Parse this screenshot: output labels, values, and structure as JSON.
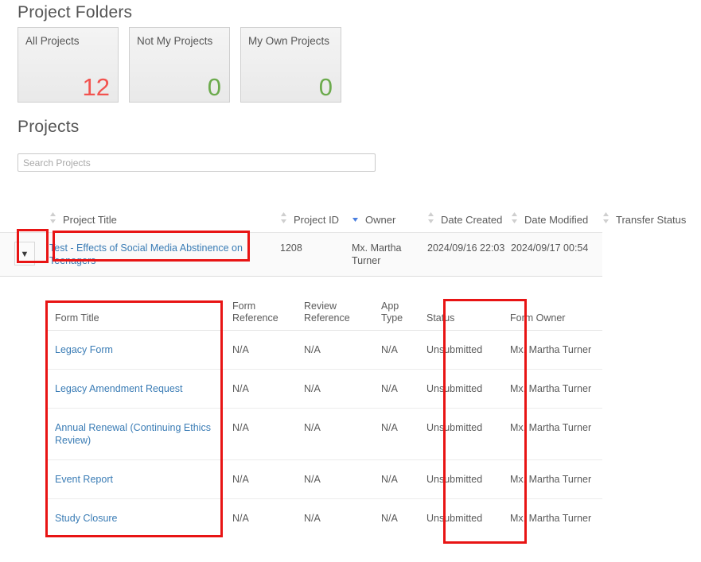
{
  "headings": {
    "project_folders": "Project Folders",
    "projects": "Projects"
  },
  "folder_cards": [
    {
      "label": "All Projects",
      "count": "12",
      "color": "#f2534f"
    },
    {
      "label": "Not My Projects",
      "count": "0",
      "color": "#6cab4d"
    },
    {
      "label": "My Own Projects",
      "count": "0",
      "color": "#6cab4d"
    }
  ],
  "search": {
    "placeholder": "Search Projects",
    "value": ""
  },
  "projects_table": {
    "columns": [
      {
        "label": "Project Title",
        "sort": "none"
      },
      {
        "label": "Project ID",
        "sort": "desc"
      },
      {
        "label": "Owner",
        "sort": "none"
      },
      {
        "label": "Date Created",
        "sort": "none"
      },
      {
        "label": "Date Modified",
        "sort": "none"
      },
      {
        "label": "Transfer Status",
        "sort": "none"
      }
    ],
    "rows": [
      {
        "expander_icon": "chevron-down",
        "title": "Test - Effects of Social Media Abstinence on Teenagers",
        "project_id": "1208",
        "owner": "Mx. Martha Turner",
        "date_created": "2024/09/16 22:03",
        "date_modified": "2024/09/17 00:54",
        "transfer_status": ""
      }
    ]
  },
  "forms_table": {
    "columns": [
      "Form Title",
      "Form Reference",
      "Review Reference",
      "App Type",
      "Status",
      "Form Owner"
    ],
    "rows": [
      {
        "title": "Legacy Form",
        "form_reference": "N/A",
        "review_reference": "N/A",
        "app_type": "N/A",
        "status": "Unsubmitted",
        "form_owner": "Mx. Martha Turner"
      },
      {
        "title": "Legacy Amendment Request",
        "form_reference": "N/A",
        "review_reference": "N/A",
        "app_type": "N/A",
        "status": "Unsubmitted",
        "form_owner": "Mx. Martha Turner"
      },
      {
        "title": "Annual Renewal (Continuing Ethics Review)",
        "form_reference": "N/A",
        "review_reference": "N/A",
        "app_type": "N/A",
        "status": "Unsubmitted",
        "form_owner": "Mx. Martha Turner"
      },
      {
        "title": "Event Report",
        "form_reference": "N/A",
        "review_reference": "N/A",
        "app_type": "N/A",
        "status": "Unsubmitted",
        "form_owner": "Mx. Martha Turner"
      },
      {
        "title": "Study Closure",
        "form_reference": "N/A",
        "review_reference": "N/A",
        "app_type": "N/A",
        "status": "Unsubmitted",
        "form_owner": "Mx. Martha Turner"
      }
    ]
  },
  "annotations": {
    "color": "#e81414",
    "boxes": [
      "expander-cell",
      "project-title-cell",
      "form-title-column",
      "status-column"
    ]
  }
}
